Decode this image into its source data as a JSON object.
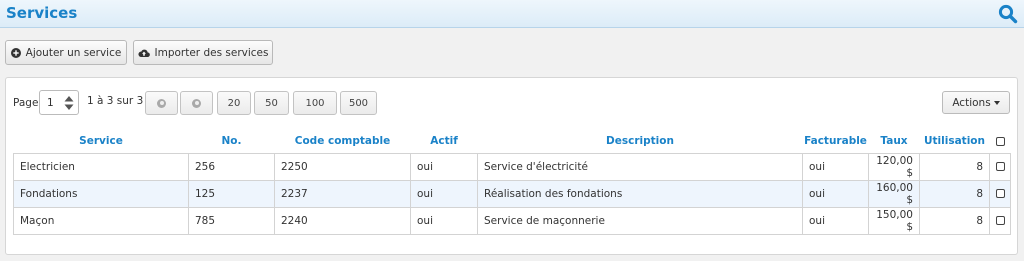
{
  "header": {
    "title": "Services"
  },
  "toolbar": {
    "add_label": "Ajouter un service",
    "import_label": "Importer des services"
  },
  "pagination": {
    "page_label": "Page",
    "page_value": "1",
    "range_label": "1 à 3 sur 3",
    "sizes": [
      "20",
      "50",
      "100",
      "500"
    ],
    "actions_label": "Actions"
  },
  "table": {
    "columns": [
      "Service",
      "No.",
      "Code comptable",
      "Actif",
      "Description",
      "Facturable",
      "Taux",
      "Utilisation"
    ],
    "rows": [
      [
        "Electricien",
        "256",
        "2250",
        "oui",
        "Service d'électricité",
        "oui",
        "120,00 $",
        "8"
      ],
      [
        "Fondations",
        "125",
        "2237",
        "oui",
        "Réalisation des fondations",
        "oui",
        "160,00 $",
        "8"
      ],
      [
        "Maçon",
        "785",
        "2240",
        "oui",
        "Service de maçonnerie",
        "oui",
        "150,00 $",
        "8"
      ]
    ]
  },
  "colors": {
    "accent": "#1a82c8",
    "row_alt": "#eef5fd"
  },
  "icons": [
    "search-icon",
    "plus-circle-icon",
    "cloud-upload-icon",
    "spinner-icon",
    "prev-page-icon",
    "next-page-icon",
    "caret-down-icon",
    "checkbox-icon"
  ]
}
